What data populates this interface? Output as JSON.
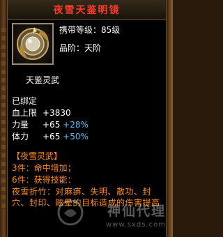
{
  "title": "夜雪天鉴明镜",
  "item": {
    "icon": "mirror-icon",
    "level_label": "携带等级：",
    "level_value": "85级",
    "grade_label": "品阶：",
    "grade_value": "天阶"
  },
  "subtitle": "天鉴灵武",
  "stats": {
    "bound": "已绑定",
    "rows": [
      {
        "label": "血上限",
        "value": "+3830",
        "pct": ""
      },
      {
        "label": "力量",
        "value": "+65",
        "pct": "+28%"
      },
      {
        "label": "体力",
        "value": "+65",
        "pct": "+50%"
      }
    ]
  },
  "set": {
    "name": "【夜雪灵武】",
    "piece3": "3件：命中增加；",
    "piece6": "6件：获得技能：",
    "skill": "夜雪折竹：对麻痹、失明、散功、封穴、封印、眩晕的目标造成的伤害提高"
  },
  "watermark": {
    "main": "神仙代理",
    "url": "www.sxds.com"
  },
  "colors": {
    "title": "#ff3a2a",
    "bonus": "#4fc0ff",
    "set": "#ff8a1a",
    "text": "#ffffff",
    "background": "#000000"
  }
}
